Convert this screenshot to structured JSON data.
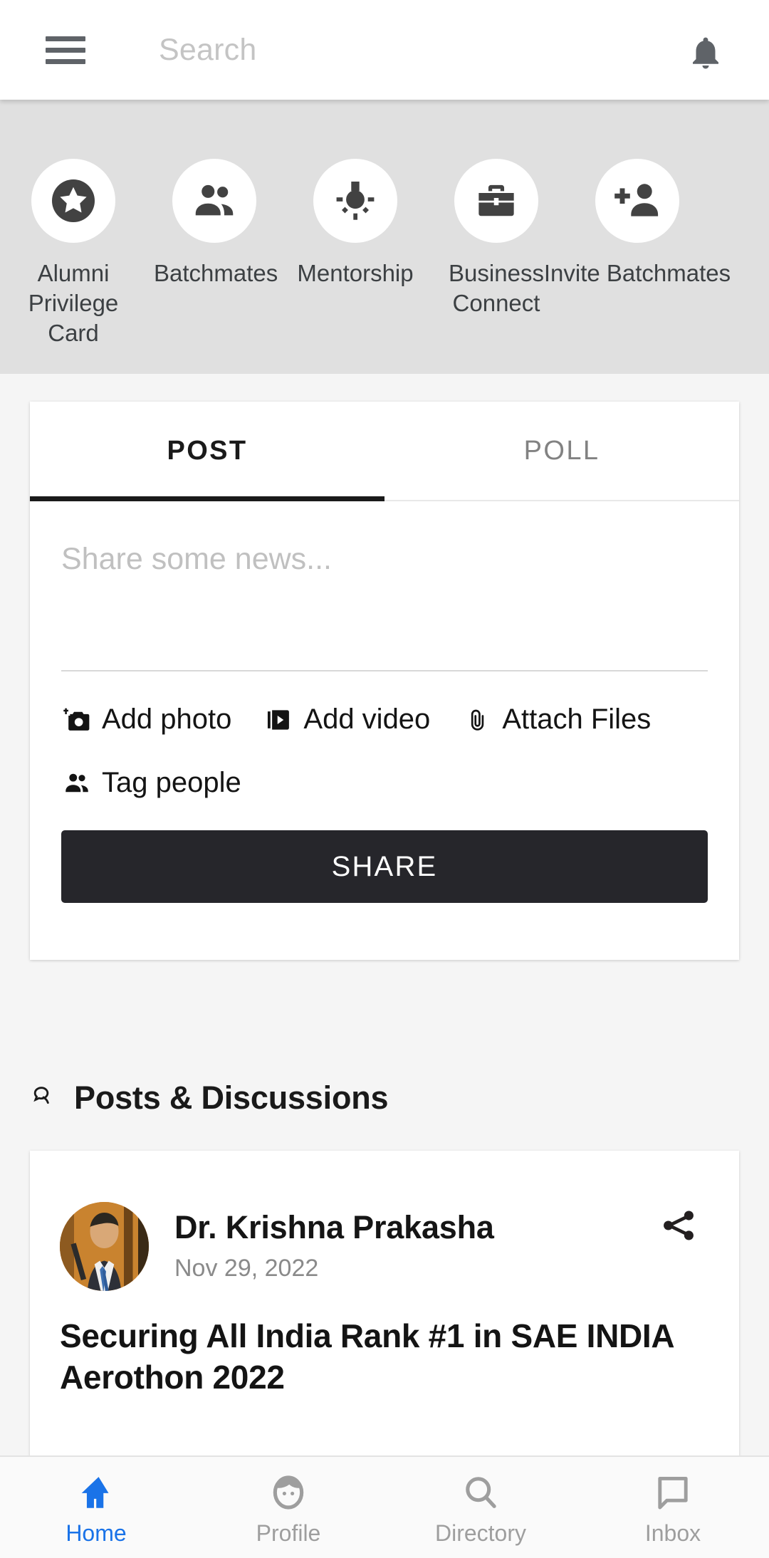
{
  "appbar": {
    "menu_icon": "hamburger-menu-icon",
    "search_placeholder": "Search",
    "search_value": "",
    "notification_icon": "bell-icon"
  },
  "shortcuts": [
    {
      "label": "Alumni\nPrivilege\nCard",
      "icon": "star-badge-icon"
    },
    {
      "label": "Batchmates",
      "icon": "people-icon"
    },
    {
      "label": "Mentorship",
      "icon": "lightbulb-icon"
    },
    {
      "label": "Business\nConnect",
      "icon": "briefcase-icon"
    },
    {
      "label": "Invite\nBatchmates",
      "icon": "person-add-icon"
    }
  ],
  "composer": {
    "tabs": [
      {
        "label": "POST",
        "active": true
      },
      {
        "label": "POLL",
        "active": false
      }
    ],
    "news_placeholder": "Share some news...",
    "news_value": "",
    "actions": [
      {
        "label": "Add photo",
        "icon": "add-photo-icon"
      },
      {
        "label": "Add video",
        "icon": "add-video-icon"
      },
      {
        "label": "Attach Files",
        "icon": "paperclip-icon"
      },
      {
        "label": "Tag people",
        "icon": "tag-people-icon"
      }
    ],
    "share_label": "SHARE"
  },
  "section": {
    "title": "Posts & Discussions",
    "icon": "comments-icon"
  },
  "post": {
    "author": "Dr. Krishna Prakasha",
    "date": "Nov 29, 2022",
    "title": "Securing All India Rank #1 in SAE INDIA Aerothon 2022",
    "share_icon": "share-icon",
    "avatar": "author-photo"
  },
  "bottom_nav": [
    {
      "label": "Home",
      "icon": "home-icon",
      "active": true
    },
    {
      "label": "Profile",
      "icon": "person-face-icon",
      "active": false
    },
    {
      "label": "Directory",
      "icon": "search-icon",
      "active": false
    },
    {
      "label": "Inbox",
      "icon": "chat-bubble-icon",
      "active": false
    }
  ],
  "colors": {
    "accent": "#1a73e8",
    "dark": "#26262b",
    "page_bg": "#f5f5f5",
    "strip_bg": "#e0e0e0",
    "icon_grey": "#9e9e9e"
  }
}
